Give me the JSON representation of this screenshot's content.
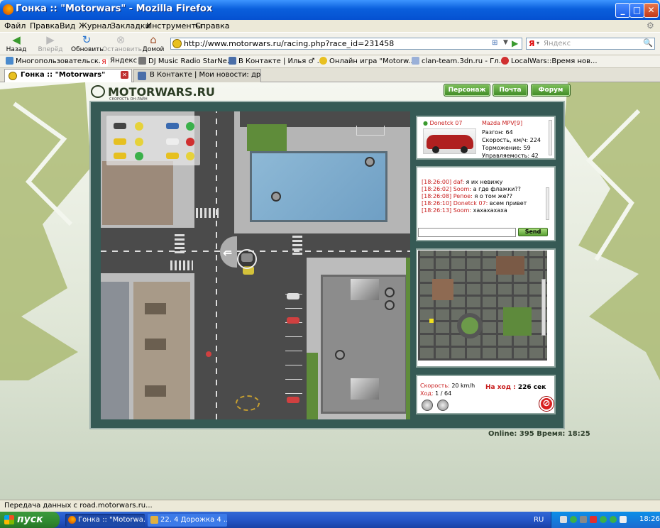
{
  "window": {
    "title": "Гонка :: \"Motorwars\" - Mozilla Firefox"
  },
  "menu": [
    "Файл",
    "Правка",
    "Вид",
    "Журнал",
    "Закладки",
    "Инструменты",
    "Справка"
  ],
  "nav": {
    "back": "Назад",
    "forward": "Вперёд",
    "reload": "Обновить",
    "stop": "Остановить",
    "home": "Домой"
  },
  "url": "http://www.motorwars.ru/racing.php?race_id=231458",
  "search_placeholder": "Яндекс",
  "bookmarks": [
    "Многопользовательск...",
    "Яндекс",
    "DJ Music Radio StarNe...",
    "В Контакте | Илья ♂ ...",
    "Онлайн игра \"Motorw...",
    "clan-team.3dn.ru - Гл...",
    "LocalWars::Время нов..."
  ],
  "tabs": [
    "Гонка :: \"Motorwars\"",
    "В Контакте | Мои новости: дру..."
  ],
  "site": {
    "logo": "MOTORWARS.RU",
    "logo_sub": "СКОРОСТЬ ОН-ЛАЙН",
    "btn_persona": "Персонаж",
    "btn_mail": "Почта",
    "btn_forum": "Форум"
  },
  "car_info": {
    "player": "Donetck 07",
    "car": "Mazda MPV[9]",
    "accel": "Разгон: 64",
    "speed": "Скорость, км/ч: 224",
    "brake": "Торможение: 59",
    "handling": "Управляемость: 42"
  },
  "chat": [
    {
      "time": "[18:26:00]",
      "nick": "daf:",
      "msg": "я их невижу"
    },
    {
      "time": "[18:26:02]",
      "nick": "Soom:",
      "msg": "а где флажки??"
    },
    {
      "time": "[18:26:08]",
      "nick": "Peпое:",
      "msg": "я о том же??"
    },
    {
      "time": "[18:26:10]",
      "nick": "Donetck 07:",
      "msg": "всем привет"
    },
    {
      "time": "[18:26:13]",
      "nick": "Soom:",
      "msg": "хахахахаха"
    }
  ],
  "chat_send": "Send",
  "race": {
    "speed_label": "Скорость:",
    "speed_val": "20 km/h",
    "move_label": "Ход:",
    "move_val": "1 / 64",
    "timer_label": "На ход :",
    "timer_val": "226 сек"
  },
  "online_status": "Online: 395  Время: 18:25",
  "statusbar": "Передача данных с road.motorwars.ru...",
  "taskbar": {
    "start": "пуск",
    "task1": "Гонка :: \"Motorwa...",
    "task2": "22. 4 Дорожка 4 ...",
    "lang": "RU",
    "clock": "18:26"
  },
  "colors": {
    "accent_green": "#4a9a2e",
    "chat_red": "#c81e1e",
    "frame": "#365a55"
  }
}
